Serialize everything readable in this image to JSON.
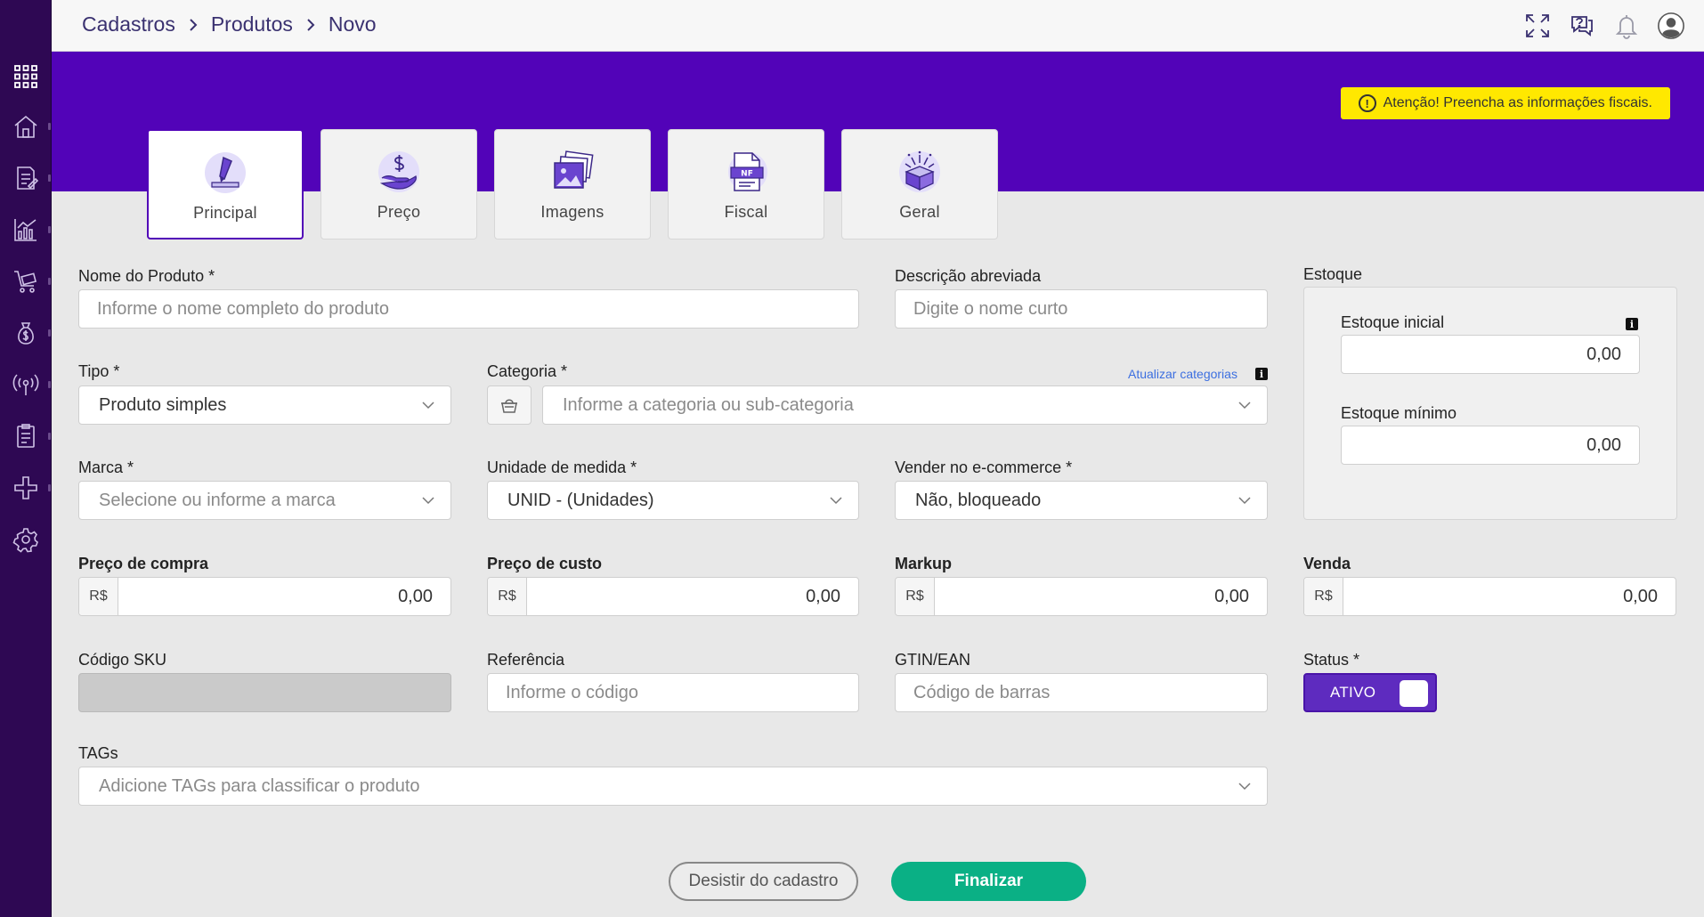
{
  "breadcrumb": [
    "Cadastros",
    "Produtos",
    "Novo"
  ],
  "alert": "Atenção! Preencha as informações fiscais.",
  "tabs": [
    {
      "label": "Principal",
      "active": true
    },
    {
      "label": "Preço"
    },
    {
      "label": "Imagens"
    },
    {
      "label": "Fiscal",
      "badge": "NF"
    },
    {
      "label": "Geral"
    }
  ],
  "form": {
    "nome": {
      "label": "Nome do Produto *",
      "placeholder": "Informe o nome completo do produto"
    },
    "descricao": {
      "label": "Descrição abreviada",
      "placeholder": "Digite o nome curto"
    },
    "tipo": {
      "label": "Tipo *",
      "value": "Produto simples"
    },
    "categoria": {
      "label": "Categoria *",
      "placeholder": "Informe a categoria ou sub-categoria",
      "link": "Atualizar categorias",
      "info": "i"
    },
    "marca": {
      "label": "Marca *",
      "placeholder": "Selecione ou informe a marca"
    },
    "unidade": {
      "label": "Unidade de medida *",
      "value": "UNID - (Unidades)"
    },
    "ecommerce": {
      "label": "Vender no e-commerce *",
      "value": "Não, bloqueado"
    },
    "preco_compra": {
      "label": "Preço de compra",
      "currency": "R$",
      "value": "0,00"
    },
    "preco_custo": {
      "label": "Preço de custo",
      "currency": "R$",
      "value": "0,00"
    },
    "markup": {
      "label": "Markup",
      "currency": "R$",
      "value": "0,00"
    },
    "venda": {
      "label": "Venda",
      "currency": "R$",
      "value": "0,00"
    },
    "sku": {
      "label": "Código SKU"
    },
    "referencia": {
      "label": "Referência",
      "placeholder": "Informe o código"
    },
    "gtin": {
      "label": "GTIN/EAN",
      "placeholder": "Código de barras"
    },
    "status": {
      "label": "Status *",
      "value": "ATIVO"
    },
    "tags": {
      "label": "TAGs",
      "placeholder": "Adicione TAGs para classificar o produto"
    }
  },
  "estoque": {
    "title": "Estoque",
    "inicial": {
      "label": "Estoque inicial",
      "value": "0,00",
      "info": "i"
    },
    "minimo": {
      "label": "Estoque mínimo",
      "value": "0,00"
    }
  },
  "buttons": {
    "cancel": "Desistir do cadastro",
    "finish": "Finalizar"
  },
  "colors": {
    "sidebar": "#2e0853",
    "band": "#5203b8",
    "alert": "#ffe800",
    "finish": "#0ab085",
    "toggle": "#5e2bbf"
  }
}
